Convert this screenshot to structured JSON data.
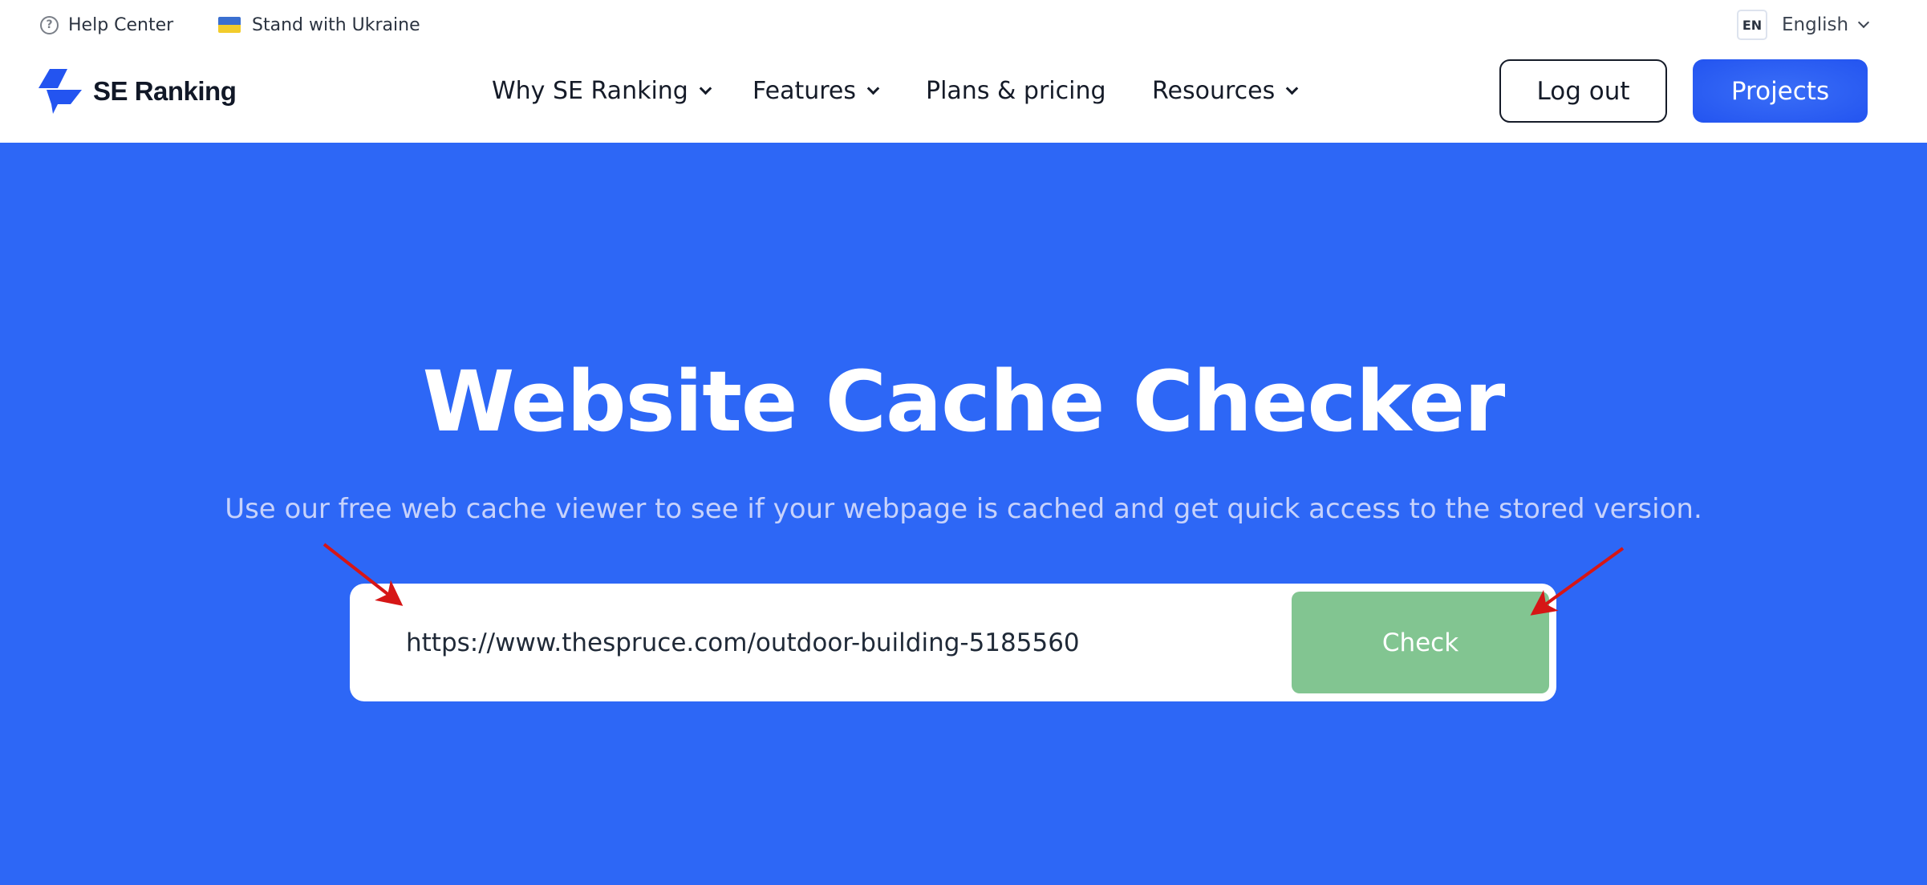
{
  "topbar": {
    "help_label": "Help Center",
    "help_icon": "question-circle-icon",
    "ukraine_label": "Stand with Ukraine",
    "ukraine_icon": "ukraine-flag-icon",
    "lang_code": "EN",
    "lang_label": "English"
  },
  "brand": {
    "name": "SE Ranking",
    "color": "#2354f0"
  },
  "nav": {
    "items": [
      {
        "label": "Why SE Ranking",
        "has_dropdown": true
      },
      {
        "label": "Features",
        "has_dropdown": true
      },
      {
        "label": "Plans & pricing",
        "has_dropdown": false
      },
      {
        "label": "Resources",
        "has_dropdown": true
      }
    ]
  },
  "actions": {
    "logout_label": "Log out",
    "projects_label": "Projects"
  },
  "hero": {
    "title": "Website Cache Checker",
    "subtitle": "Use our free web cache viewer to see if your webpage is cached and get quick access to the stored version.",
    "background": "#2d67f6"
  },
  "search": {
    "url_value": "https://www.thespruce.com/outdoor-building-5185560",
    "check_label": "Check",
    "check_color": "#82c591"
  },
  "annotations": {
    "arrow_color": "#d61616",
    "arrows": [
      "pointing-to-url-input",
      "pointing-to-check-button"
    ]
  }
}
